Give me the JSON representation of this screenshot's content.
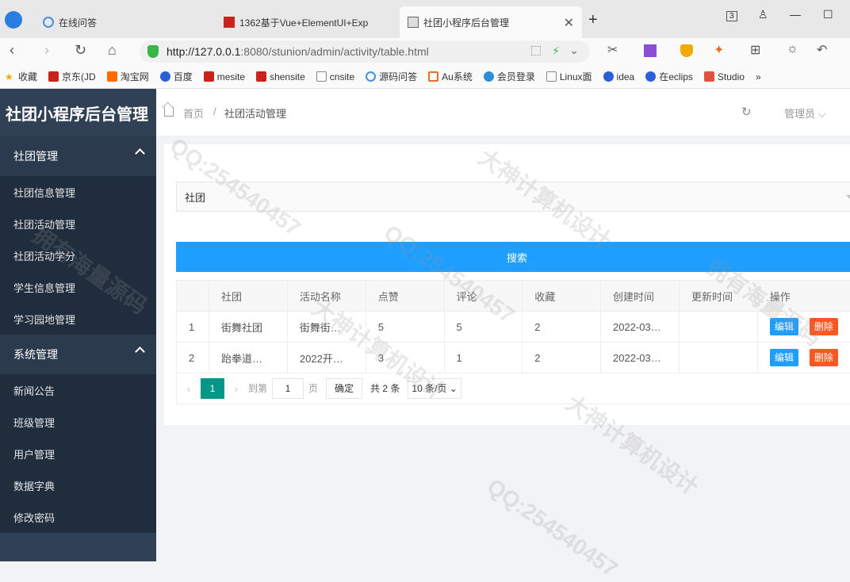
{
  "browser": {
    "tabs": [
      {
        "label": "在线问答",
        "active": false
      },
      {
        "label": "1362基于Vue+ElementUI+Exp",
        "active": false
      },
      {
        "label": "社团小程序后台管理",
        "active": true
      }
    ],
    "tab_count_badge": "3",
    "url_host": "http://127.0.0.1",
    "url_path": ":8080/stunion/admin/activity/table.html",
    "bookmarks": [
      "收藏",
      "京东(JD",
      "淘宝网",
      "百度",
      "mesite",
      "shensite",
      "cnsite",
      "源码问答",
      "Au系统",
      "会员登录",
      "Linux面",
      "idea",
      "在eclips",
      "Studio",
      "»"
    ]
  },
  "sidebar": {
    "brand": "社团小程序后台管理",
    "groups": [
      {
        "title": "社团管理",
        "items": [
          "社团信息管理",
          "社团活动管理",
          "社团活动学分",
          "学生信息管理",
          "学习园地管理"
        ]
      },
      {
        "title": "系统管理",
        "items": [
          "新闻公告",
          "班级管理",
          "用户管理",
          "数据字典",
          "修改密码"
        ]
      }
    ]
  },
  "topbar": {
    "crumb_home": "首页",
    "crumb_sep": "/",
    "crumb_current": "社团活动管理",
    "user": "管理员 ⌵"
  },
  "filter": {
    "select_value": "社团",
    "search_label": "搜索"
  },
  "table": {
    "headers": [
      "",
      "社团",
      "活动名称",
      "点赞",
      "评论",
      "收藏",
      "创建时间",
      "更新时间",
      "操作"
    ],
    "rows": [
      {
        "idx": "1",
        "club": "街舞社团",
        "name": "街舞街…",
        "likes": "5",
        "comments": "5",
        "favs": "2",
        "created": "2022-03…",
        "updated": ""
      },
      {
        "idx": "2",
        "club": "跆拳道…",
        "name": "2022开…",
        "likes": "3",
        "comments": "1",
        "favs": "2",
        "created": "2022-03…",
        "updated": ""
      }
    ],
    "edit_label": "编辑",
    "delete_label": "删除"
  },
  "pager": {
    "current": "1",
    "goto_prefix": "到第",
    "goto_value": "1",
    "goto_suffix": "页",
    "confirm": "确定",
    "total": "共 2 条",
    "page_size": "10 条/页 ⌄"
  },
  "watermarks": [
    "大神计算机设计",
    "QQ:254540457",
    "拥有海量源码"
  ]
}
